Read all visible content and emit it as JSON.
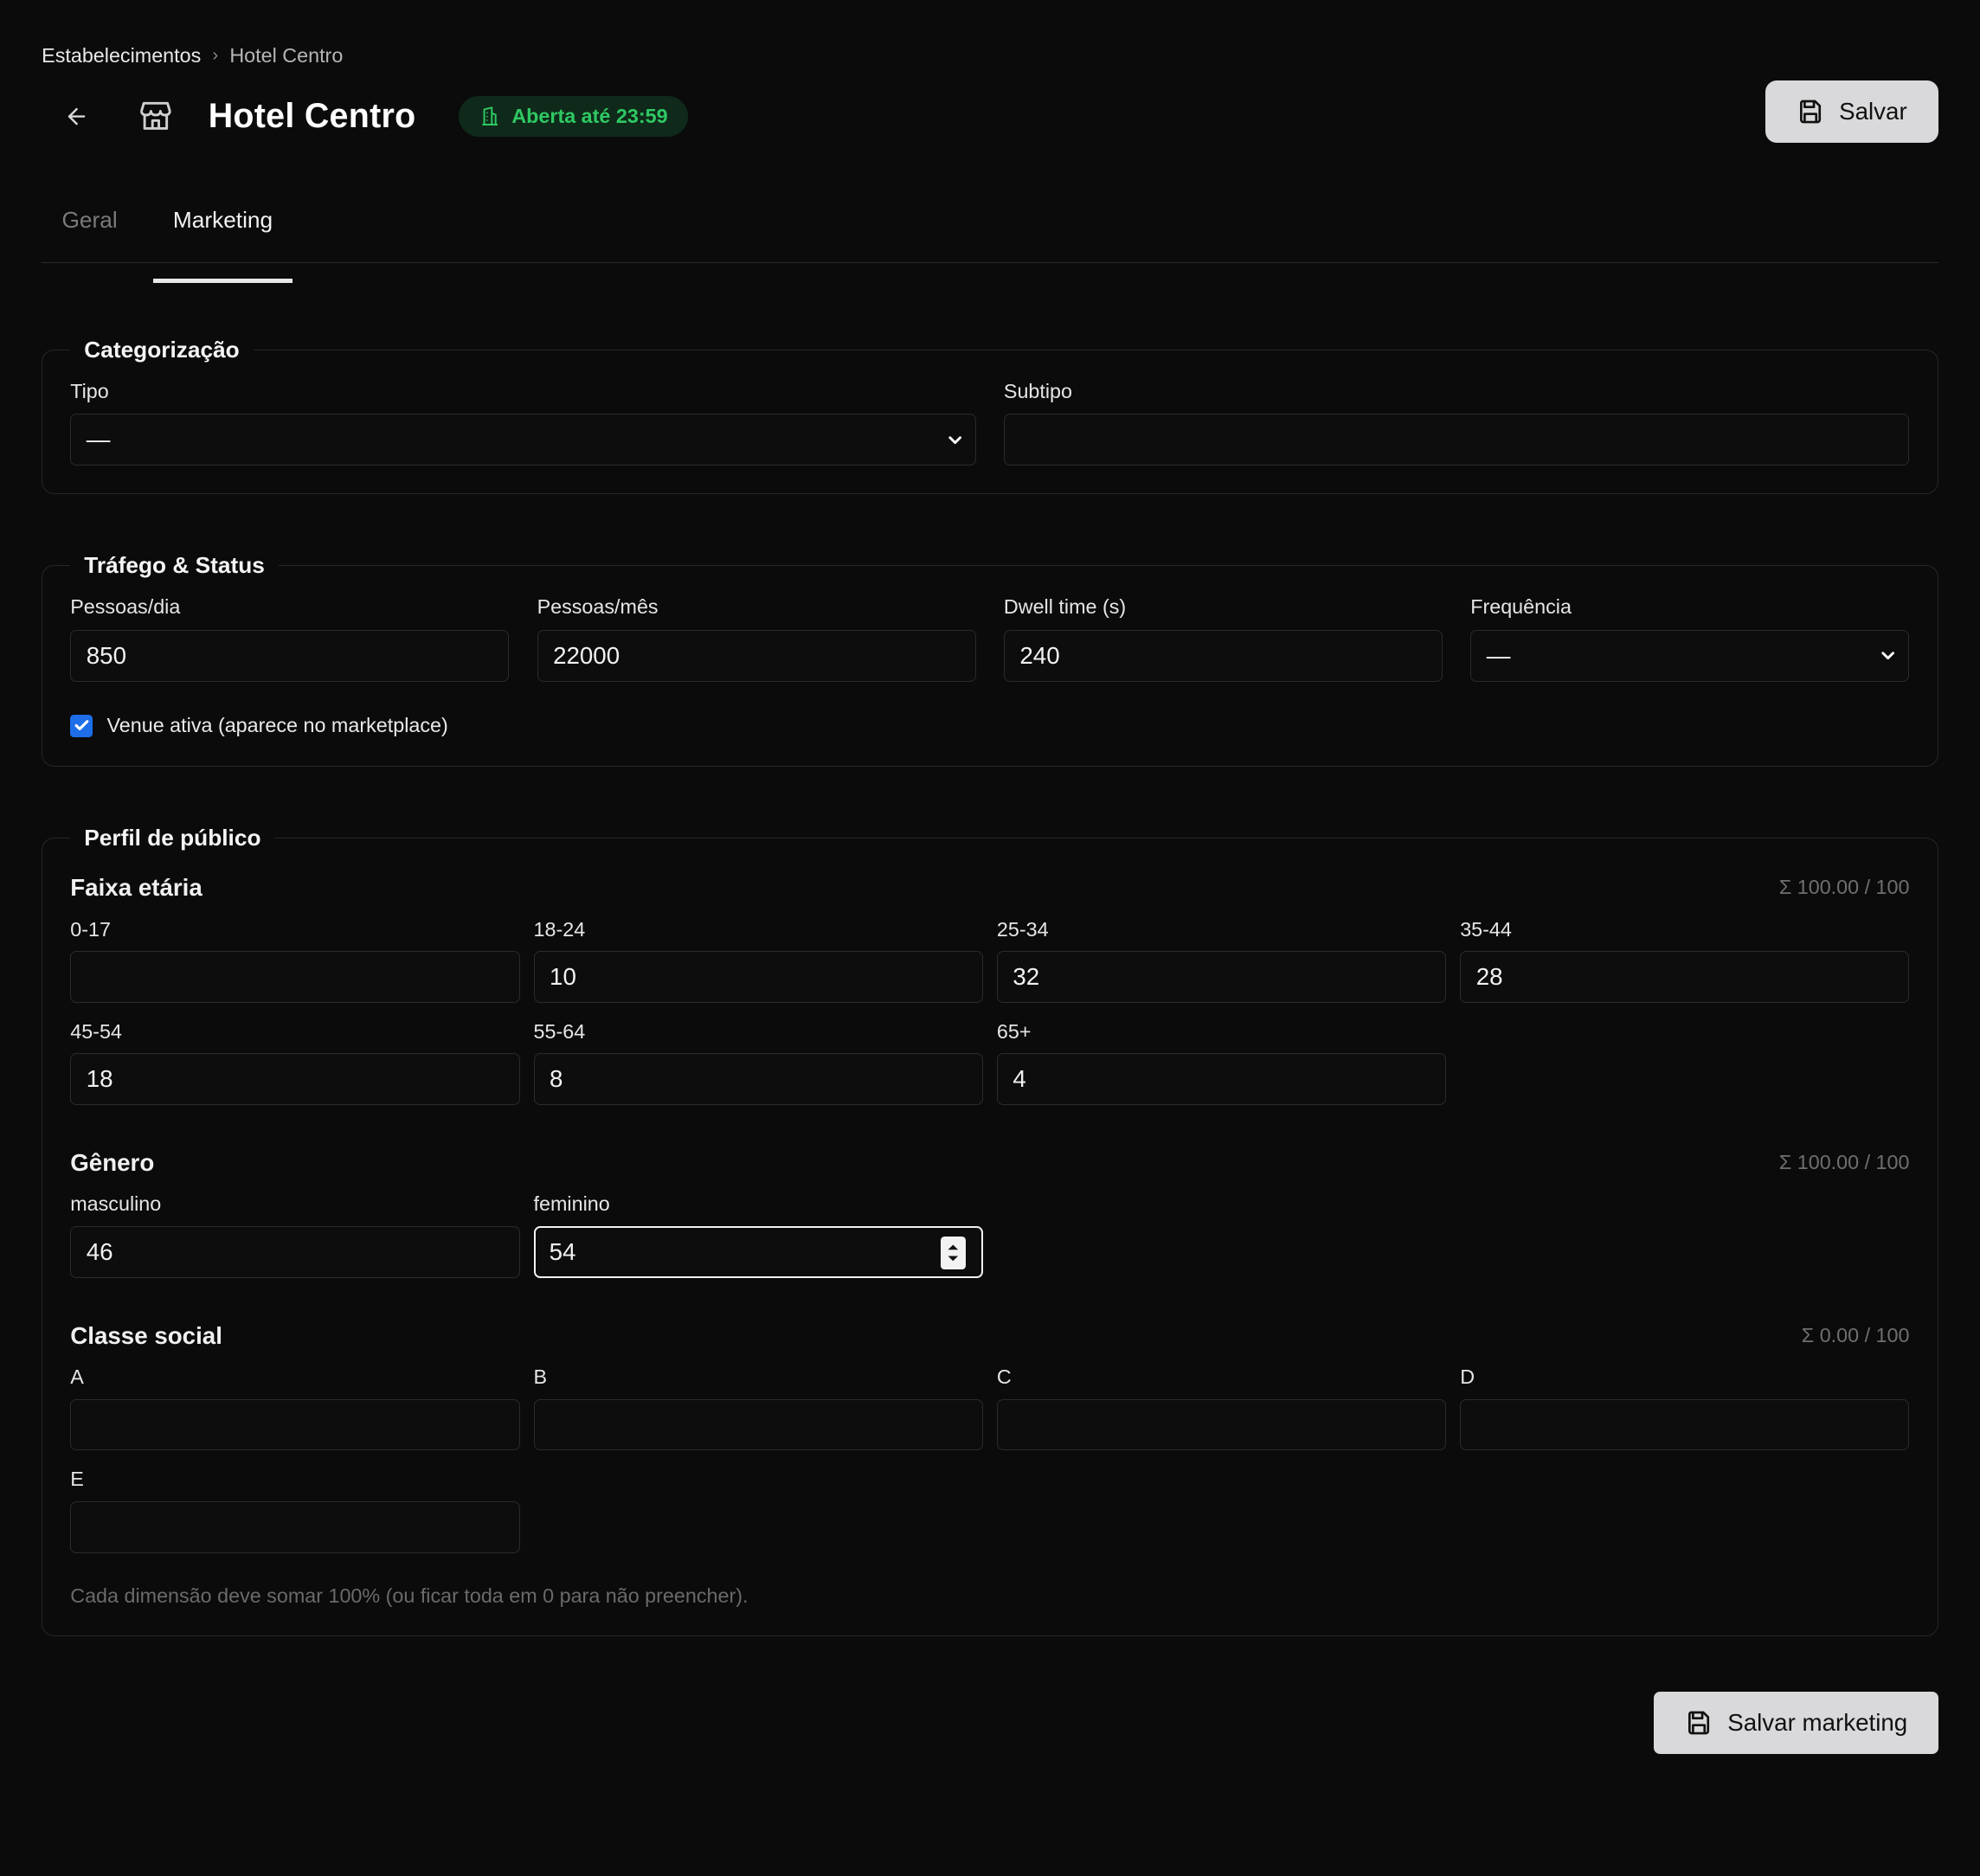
{
  "breadcrumb": {
    "root": "Estabelecimentos",
    "separator": "›",
    "current": "Hotel Centro"
  },
  "header": {
    "title": "Hotel Centro",
    "status_badge": "Aberta até 23:59",
    "save_label": "Salvar",
    "icons": [
      "arrow-left-icon",
      "store-icon",
      "building-icon",
      "save-icon"
    ]
  },
  "tabs": [
    {
      "label": "Geral",
      "active": false
    },
    {
      "label": "Marketing",
      "active": true
    }
  ],
  "categorizacao": {
    "legend": "Categorização",
    "tipo": {
      "label": "Tipo",
      "value": "—"
    },
    "subtipo": {
      "label": "Subtipo",
      "value": ""
    }
  },
  "trafego": {
    "legend": "Tráfego & Status",
    "pessoas_dia": {
      "label": "Pessoas/dia",
      "value": "850"
    },
    "pessoas_mes": {
      "label": "Pessoas/mês",
      "value": "22000"
    },
    "dwell": {
      "label": "Dwell time (s)",
      "value": "240"
    },
    "frequencia": {
      "label": "Frequência",
      "value": "—"
    },
    "venue_ativa": {
      "label": "Venue ativa (aparece no marketplace)",
      "checked": true
    }
  },
  "perfil": {
    "legend": "Perfil de público",
    "faixa": {
      "title": "Faixa etária",
      "sum": "Σ 100.00 / 100",
      "fields": [
        {
          "label": "0-17",
          "value": ""
        },
        {
          "label": "18-24",
          "value": "10"
        },
        {
          "label": "25-34",
          "value": "32"
        },
        {
          "label": "35-44",
          "value": "28"
        },
        {
          "label": "45-54",
          "value": "18"
        },
        {
          "label": "55-64",
          "value": "8"
        },
        {
          "label": "65+",
          "value": "4"
        }
      ]
    },
    "genero": {
      "title": "Gênero",
      "sum": "Σ 100.00 / 100",
      "fields": [
        {
          "label": "masculino",
          "value": "46"
        },
        {
          "label": "feminino",
          "value": "54"
        }
      ]
    },
    "classe": {
      "title": "Classe social",
      "sum": "Σ 0.00 / 100",
      "fields": [
        {
          "label": "A",
          "value": ""
        },
        {
          "label": "B",
          "value": ""
        },
        {
          "label": "C",
          "value": ""
        },
        {
          "label": "D",
          "value": ""
        },
        {
          "label": "E",
          "value": ""
        }
      ]
    },
    "hint": "Cada dimensão deve somar 100% (ou ficar toda em 0 para não preencher)."
  },
  "footer": {
    "save_marketing_label": "Salvar marketing"
  },
  "colors": {
    "background": "#0b0b0b",
    "badge_text": "#2fc863",
    "badge_bg": "#0f2a1a",
    "button_bg": "#d9d9db",
    "checkbox": "#1d6ee8"
  }
}
